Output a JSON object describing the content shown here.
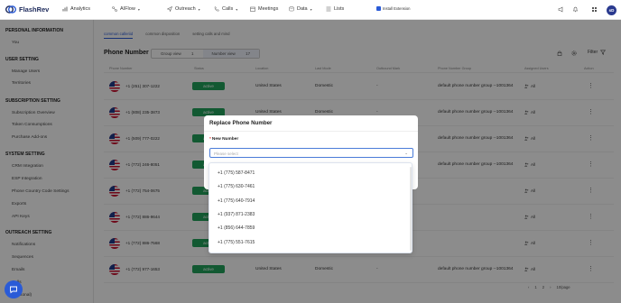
{
  "app": {
    "name": "FlashRev",
    "brand_color": "#1d2a5b",
    "accent_color": "#2a5bd7"
  },
  "nav": [
    {
      "label": "Analytics",
      "icon": "chart-icon",
      "has_caret": false
    },
    {
      "label": "AIFlow",
      "icon": "flow-icon",
      "has_caret": true
    },
    {
      "label": "Outreach",
      "icon": "send-icon",
      "has_caret": true
    },
    {
      "label": "Calls",
      "icon": "phone-icon",
      "has_caret": true
    },
    {
      "label": "Meetings",
      "icon": "calendar-icon",
      "has_caret": false
    },
    {
      "label": "Data",
      "icon": "database-icon",
      "has_caret": true
    },
    {
      "label": "Lists",
      "icon": "list-icon",
      "has_caret": false
    }
  ],
  "top_right": {
    "extension_label": "Install Extension",
    "avatar_initials": "sD"
  },
  "sidebar": {
    "sections": [
      {
        "title": "PERSONAL INFORMATION",
        "items": [
          "You"
        ]
      },
      {
        "title": "USER SETTING",
        "items": [
          "Manage Users",
          "Territories"
        ]
      },
      {
        "title": "SUBSCRIPTION SETTING",
        "items": [
          "Subscription Overview",
          "Token Consumptions",
          "Purchase Add-ons"
        ]
      },
      {
        "title": "SYSTEM SETTING",
        "items": [
          "CRM Integration",
          "ESP Integration",
          "Phone Country Code Settings",
          "Exports",
          "API Keys"
        ]
      },
      {
        "title": "OUTREACH SETTING",
        "items": [
          "Notifications",
          "Sequences",
          "Emails",
          "Calls",
          "(Personal)"
        ]
      }
    ]
  },
  "main": {
    "tabs": [
      "common calleriid",
      "common disposition",
      "setting calls and mind"
    ],
    "active_tab": 0,
    "title": "Phone Number",
    "group_view_label": "Group view",
    "group_view_count": "1",
    "number_view_label": "Number view",
    "number_view_count": "17",
    "filter_label": "Filter",
    "columns": [
      "Phone Number",
      "Status",
      "Location",
      "Last Mode",
      "Outbound Mark",
      "Phone Number Group",
      "Assigned Users",
      "Action"
    ],
    "rows": [
      {
        "number": "+1 (251) 307-1222",
        "status": "active",
        "location": "United States",
        "last": "Domestic",
        "mark": "-",
        "group": "default phone number group --1001364",
        "assigned": "All"
      },
      {
        "number": "+1 (808) 235-3873",
        "status": "active",
        "location": "United States",
        "last": "Domestic",
        "mark": "-",
        "group": "default phone number group --1001364",
        "assigned": "All"
      },
      {
        "number": "+1 (509) 777-0222",
        "status": "active",
        "location": "",
        "last": "",
        "mark": "",
        "group": "default phone number group --1001364",
        "assigned": "All"
      },
      {
        "number": "+1 (772) 246-8051",
        "status": "active",
        "location": "",
        "last": "",
        "mark": "",
        "group": "default phone number group --1001364",
        "assigned": "All"
      },
      {
        "number": "+1 (772) 754-0675",
        "status": "active",
        "location": "",
        "last": "",
        "mark": "",
        "group": "",
        "assigned": "All"
      },
      {
        "number": "+1 (772) 886-9644",
        "status": "active",
        "location": "",
        "last": "",
        "mark": "",
        "group": "",
        "assigned": "All"
      },
      {
        "number": "+1 (772) 886-7568",
        "status": "active",
        "location": "",
        "last": "",
        "mark": "",
        "group": "",
        "assigned": "All"
      },
      {
        "number": "+1 (772) 977-1653",
        "status": "active",
        "location": "United States",
        "last": "Domestic",
        "mark": "-",
        "group": "default phone number group --1001364",
        "assigned": "All"
      }
    ],
    "pagination": {
      "pages": [
        "1",
        "2"
      ],
      "page_size": "10/page"
    }
  },
  "modal": {
    "title": "Replace Phone Number",
    "field_label": "New Number",
    "placeholder": "Please select",
    "options": [
      "+1 (775) 587-8471",
      "+1 (775) 630-7461",
      "+1 (775) 640-7914",
      "+1 (937) 871-2383",
      "+1 (856) 644-7859",
      "+1 (775) 551-7615"
    ]
  }
}
